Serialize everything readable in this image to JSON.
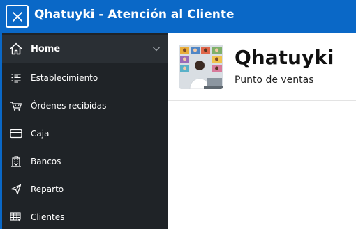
{
  "window": {
    "title": "Qhatuyki - Atención al Cliente",
    "accent_color": "#0a68c7"
  },
  "sidebar": {
    "items": [
      {
        "label": "Home",
        "icon": "home-icon",
        "active": true,
        "expandable": true
      },
      {
        "label": "Establecimiento",
        "icon": "list-icon"
      },
      {
        "label": "Órdenes recibidas",
        "icon": "cart-icon"
      },
      {
        "label": "Caja",
        "icon": "credit-card-icon"
      },
      {
        "label": "Bancos",
        "icon": "building-icon"
      },
      {
        "label": "Reparto",
        "icon": "send-icon"
      },
      {
        "label": "Clientes",
        "icon": "customers-table-icon"
      }
    ]
  },
  "main": {
    "brand_name": "Qhatuyki",
    "brand_subtitle": "Punto de ventas",
    "logo": "video-call-illustration"
  }
}
